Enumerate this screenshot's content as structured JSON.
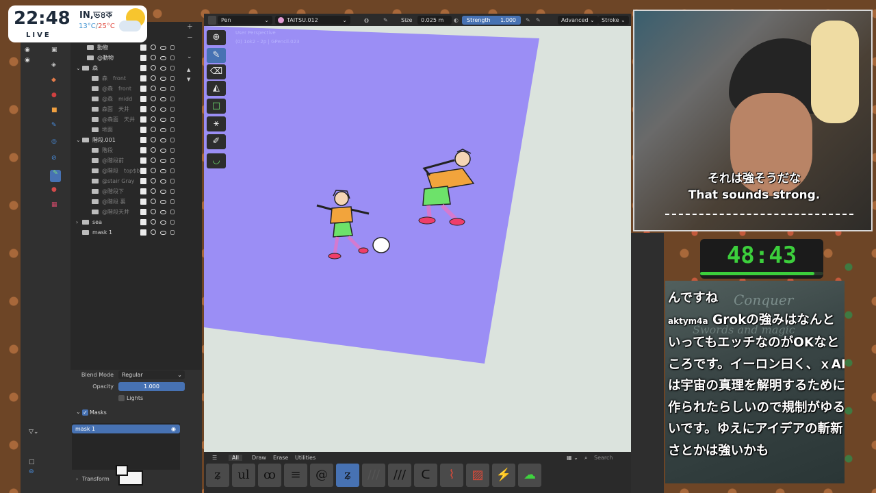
{
  "weather": {
    "time": "22:48",
    "live": "LIVE",
    "region": "IN,ভ৪ক",
    "temp_low": "13°C",
    "temp_sep": "/",
    "temp_high": "25°C"
  },
  "outliner": {
    "rows": [
      {
        "label": "動物",
        "indent": 1,
        "dim": false
      },
      {
        "label": "@動物",
        "indent": 1,
        "dim": false
      },
      {
        "label": "森",
        "indent": 0,
        "dim": false,
        "expandable": true
      },
      {
        "label": "森　front",
        "indent": 2,
        "dim": true
      },
      {
        "label": "@森　front",
        "indent": 2,
        "dim": true
      },
      {
        "label": "@森　midd",
        "indent": 2,
        "dim": true
      },
      {
        "label": "森面　天井",
        "indent": 2,
        "dim": true
      },
      {
        "label": "@森面　天井",
        "indent": 2,
        "dim": true
      },
      {
        "label": "地面",
        "indent": 2,
        "dim": true
      },
      {
        "label": "階段.001",
        "indent": 0,
        "dim": false,
        "expandable": true
      },
      {
        "label": "階段",
        "indent": 2,
        "dim": true
      },
      {
        "label": "@階段前",
        "indent": 2,
        "dim": true
      },
      {
        "label": "@階段　top$b",
        "indent": 2,
        "dim": true
      },
      {
        "label": "@stair Gray",
        "indent": 2,
        "dim": true
      },
      {
        "label": "@階段下",
        "indent": 2,
        "dim": true
      },
      {
        "label": "@階段 裏",
        "indent": 2,
        "dim": true
      },
      {
        "label": "@階段天井",
        "indent": 2,
        "dim": true
      },
      {
        "label": "sea",
        "indent": 0,
        "dim": false,
        "expandable": true,
        "collapsed": true
      },
      {
        "label": "mask 1",
        "indent": 0,
        "dim": false
      }
    ]
  },
  "properties": {
    "blend_mode_label": "Blend Mode",
    "blend_mode_value": "Regular",
    "opacity_label": "Opacity",
    "opacity_value": "1.000",
    "lights_label": "Lights",
    "masks_label": "Masks",
    "mask_item": "mask 1",
    "transform_label": "Transform"
  },
  "header": {
    "mode": "Pen",
    "material": "TAITSU.012",
    "size_label": "Size",
    "size_value": "0.025 m",
    "strength_label": "Strength",
    "strength_value": "1.000",
    "advanced": "Advanced",
    "stroke": "Stroke"
  },
  "viewport": {
    "overlay_title": "User Perspective",
    "overlay_sub": "(0) 1ok2 - 2p | GPencil.023",
    "canvas_color": "#9b8ef5"
  },
  "brush_bar": {
    "tabs": [
      "All",
      "Draw",
      "Erase",
      "Utilities"
    ],
    "search_placeholder": "Search"
  },
  "webcam": {
    "subtitle_jp": "それは強そうだな",
    "subtitle_en": "That sounds strong."
  },
  "timer": {
    "value": "48:43",
    "progress": 0.93
  },
  "chat": {
    "line0": "んですね",
    "user": "aktym4a",
    "message": "Grokの強みはなんといってもエッチなのがOKなところです。イーロン曰く、ｘAIは宇宙の真理を解明するために作られたらしいので規制がゆるいです。ゆえにアイデアの斬新さとかは強いかも",
    "bg_title_1": "Conquer",
    "bg_title_2": "Swords and magic"
  },
  "colors": {
    "accent": "#4772b3",
    "canvas": "#9b8ef5",
    "viewport_bg": "#dbe3dd",
    "timer_green": "#3ccf3c"
  }
}
